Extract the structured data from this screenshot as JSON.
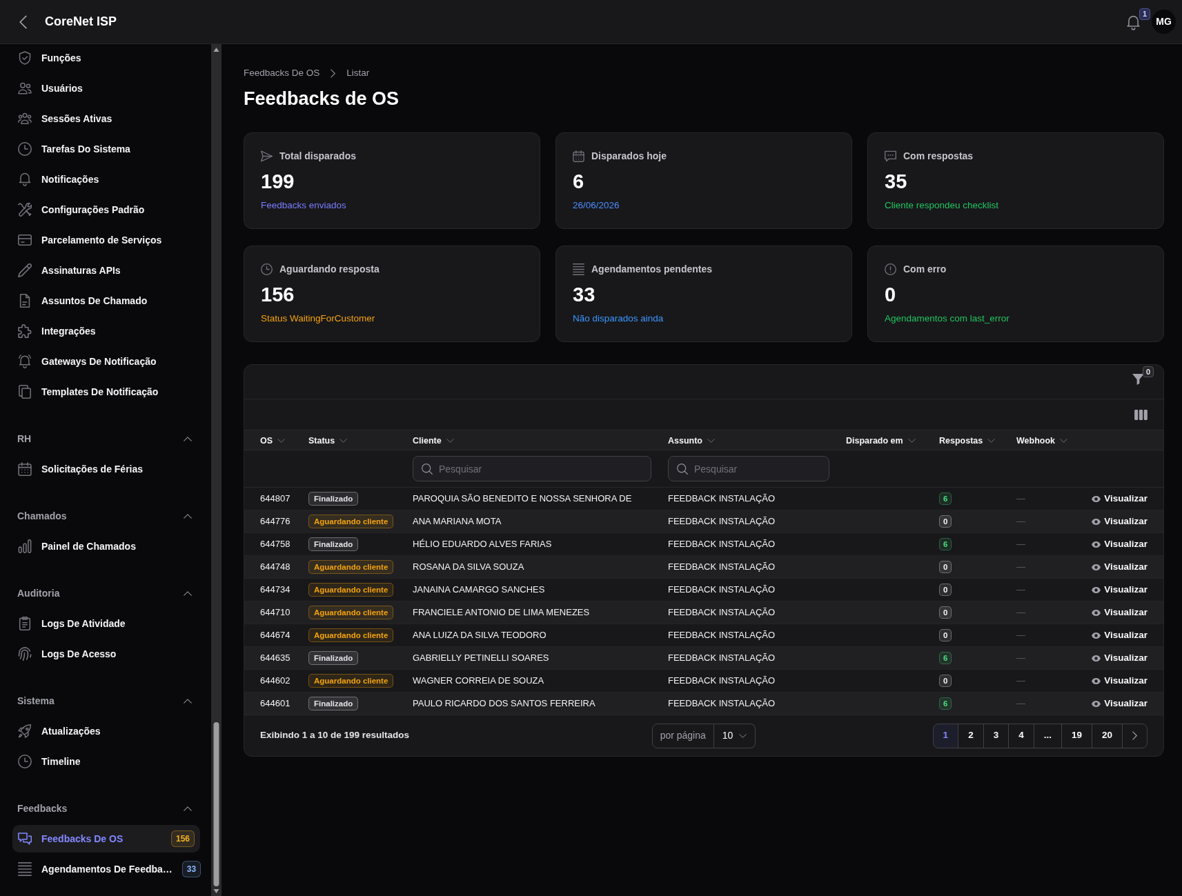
{
  "topbar": {
    "title": "CoreNet ISP",
    "notification_count": "1",
    "avatar_initials": "MG"
  },
  "sidebar": {
    "sections": [
      {
        "items": [
          {
            "label": "Funções",
            "selected": false
          },
          {
            "label": "Usuários",
            "selected": false
          },
          {
            "label": "Sessões Ativas",
            "selected": false
          },
          {
            "label": "Tarefas Do Sistema",
            "selected": false
          },
          {
            "label": "Notificações",
            "selected": false
          },
          {
            "label": "Configurações Padrão",
            "selected": false
          },
          {
            "label": "Parcelamento de Serviços",
            "selected": false
          },
          {
            "label": "Assinaturas APIs",
            "selected": false
          },
          {
            "label": "Assuntos De Chamado",
            "selected": false
          },
          {
            "label": "Integrações",
            "selected": false
          },
          {
            "label": "Gateways De Notificação",
            "selected": false
          },
          {
            "label": "Templates De Notificação",
            "selected": false
          }
        ]
      },
      {
        "title": "RH",
        "expanded": true,
        "items": [
          {
            "label": "Solicitações de Férias",
            "selected": false
          }
        ]
      },
      {
        "title": "Chamados",
        "expanded": true,
        "items": [
          {
            "label": "Painel de Chamados",
            "selected": false
          }
        ]
      },
      {
        "title": "Auditoria",
        "expanded": true,
        "items": [
          {
            "label": "Logs De Atividade",
            "selected": false
          },
          {
            "label": "Logs De Acesso",
            "selected": false
          }
        ]
      },
      {
        "title": "Sistema",
        "expanded": true,
        "items": [
          {
            "label": "Atualizações",
            "selected": false
          },
          {
            "label": "Timeline",
            "selected": false
          }
        ]
      },
      {
        "title": "Feedbacks",
        "expanded": true,
        "items": [
          {
            "label": "Feedbacks De OS",
            "selected": true,
            "badge": {
              "text": "156",
              "color": "#f5b324"
            }
          },
          {
            "label": "Agendamentos De Feedba…",
            "selected": false,
            "badge": {
              "text": "33",
              "color": "#8ab8ff"
            }
          }
        ]
      }
    ]
  },
  "breadcrumb": [
    "Feedbacks De OS",
    "Listar"
  ],
  "page_title": "Feedbacks de OS",
  "stats": [
    {
      "title": "Total disparados",
      "value": "199",
      "note": "Feedbacks enviados",
      "color": "#7a7cff"
    },
    {
      "title": "Disparados hoje",
      "value": "6",
      "note": "26/06/2026",
      "color": "#4d8eff"
    },
    {
      "title": "Com respostas",
      "value": "35",
      "note": "Cliente respondeu checklist",
      "color": "#22c55e"
    },
    {
      "title": "Aguardando resposta",
      "value": "156",
      "note": "Status WaitingForCustomer",
      "color": "#f5a30b"
    },
    {
      "title": "Agendamentos pendentes",
      "value": "33",
      "note": "Não disparados ainda",
      "color": "#3b96ff"
    },
    {
      "title": "Com erro",
      "value": "0",
      "note": "Agendamentos com last_error",
      "color": "#22c55e"
    }
  ],
  "table": {
    "filter_count": "0",
    "columns": [
      {
        "label": "OS"
      },
      {
        "label": "Status"
      },
      {
        "label": "Cliente",
        "search": {
          "placeholder": "Pesquisar"
        }
      },
      {
        "label": "Assunto",
        "search": {
          "placeholder": "Pesquisar"
        }
      },
      {
        "label": "Disparado em"
      },
      {
        "label": "Respostas"
      },
      {
        "label": "Webhook"
      }
    ],
    "rows": [
      {
        "os": "644807",
        "status": {
          "label": "Finalizado",
          "color": "#e4e4e7"
        },
        "cliente": "PAROQUIA SÃO BENEDITO E NOSSA SENHORA DE",
        "assunto": "FEEDBACK INSTALAÇÃO",
        "respostas": {
          "count": "6",
          "color": "#4ade80"
        },
        "webhook": "—",
        "action": "Visualizar"
      },
      {
        "os": "644776",
        "status": {
          "label": "Aguardando cliente",
          "color": "#f5a30b"
        },
        "cliente": "ANA MARIANA MOTA",
        "assunto": "FEEDBACK INSTALAÇÃO",
        "respostas": {
          "count": "0",
          "color": "#f4f4f5"
        },
        "webhook": "—",
        "action": "Visualizar"
      },
      {
        "os": "644758",
        "status": {
          "label": "Finalizado",
          "color": "#e4e4e7"
        },
        "cliente": "HÉLIO EDUARDO ALVES FARIAS",
        "assunto": "FEEDBACK INSTALAÇÃO",
        "respostas": {
          "count": "6",
          "color": "#4ade80"
        },
        "webhook": "—",
        "action": "Visualizar"
      },
      {
        "os": "644748",
        "status": {
          "label": "Aguardando cliente",
          "color": "#f5a30b"
        },
        "cliente": "ROSANA DA SILVA SOUZA",
        "assunto": "FEEDBACK INSTALAÇÃO",
        "respostas": {
          "count": "0",
          "color": "#f4f4f5"
        },
        "webhook": "—",
        "action": "Visualizar"
      },
      {
        "os": "644734",
        "status": {
          "label": "Aguardando cliente",
          "color": "#f5a30b"
        },
        "cliente": "JANAINA CAMARGO SANCHES",
        "assunto": "FEEDBACK INSTALAÇÃO",
        "respostas": {
          "count": "0",
          "color": "#f4f4f5"
        },
        "webhook": "—",
        "action": "Visualizar"
      },
      {
        "os": "644710",
        "status": {
          "label": "Aguardando cliente",
          "color": "#f5a30b"
        },
        "cliente": "FRANCIELE ANTONIO DE LIMA MENEZES",
        "assunto": "FEEDBACK INSTALAÇÃO",
        "respostas": {
          "count": "0",
          "color": "#f4f4f5"
        },
        "webhook": "—",
        "action": "Visualizar"
      },
      {
        "os": "644674",
        "status": {
          "label": "Aguardando cliente",
          "color": "#f5a30b"
        },
        "cliente": "ANA LUIZA DA SILVA TEODORO",
        "assunto": "FEEDBACK INSTALAÇÃO",
        "respostas": {
          "count": "0",
          "color": "#f4f4f5"
        },
        "webhook": "—",
        "action": "Visualizar"
      },
      {
        "os": "644635",
        "status": {
          "label": "Finalizado",
          "color": "#e4e4e7"
        },
        "cliente": "GABRIELLY PETINELLI SOARES",
        "assunto": "FEEDBACK INSTALAÇÃO",
        "respostas": {
          "count": "6",
          "color": "#4ade80"
        },
        "webhook": "—",
        "action": "Visualizar"
      },
      {
        "os": "644602",
        "status": {
          "label": "Aguardando cliente",
          "color": "#f5a30b"
        },
        "cliente": "WAGNER CORREIA DE SOUZA",
        "assunto": "FEEDBACK INSTALAÇÃO",
        "respostas": {
          "count": "0",
          "color": "#f4f4f5"
        },
        "webhook": "—",
        "action": "Visualizar"
      },
      {
        "os": "644601",
        "status": {
          "label": "Finalizado",
          "color": "#e4e4e7"
        },
        "cliente": "PAULO RICARDO DOS SANTOS FERREIRA",
        "assunto": "FEEDBACK INSTALAÇÃO",
        "respostas": {
          "count": "6",
          "color": "#4ade80"
        },
        "webhook": "—",
        "action": "Visualizar"
      }
    ],
    "footer": {
      "summary": "Exibindo 1 a 10 de 199 resultados",
      "per_page_label": "por página",
      "per_page": "10",
      "pages": [
        {
          "label": "1",
          "selected": true
        },
        {
          "label": "2",
          "selected": false
        },
        {
          "label": "3",
          "selected": false
        },
        {
          "label": "4",
          "selected": false
        },
        {
          "label": "...",
          "selected": false
        },
        {
          "label": "19",
          "selected": false
        },
        {
          "label": "20",
          "selected": false
        }
      ]
    }
  }
}
